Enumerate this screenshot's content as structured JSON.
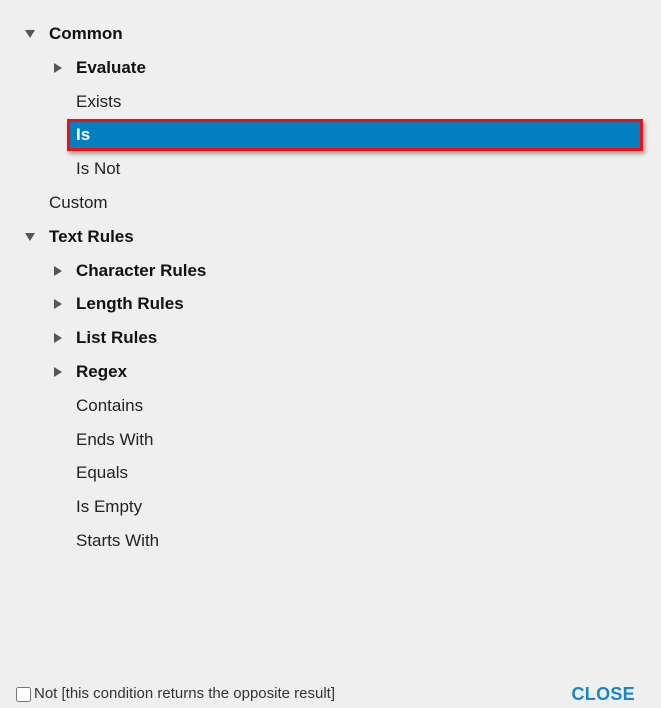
{
  "tree": {
    "common": {
      "label": "Common",
      "expanded": true,
      "children": {
        "evaluate": {
          "label": "Evaluate",
          "expanded": false
        },
        "exists": {
          "label": "Exists"
        },
        "is": {
          "label": "Is",
          "selected": true
        },
        "is_not": {
          "label": "Is Not"
        }
      }
    },
    "custom": {
      "label": "Custom"
    },
    "text_rules": {
      "label": "Text Rules",
      "expanded": true,
      "children": {
        "character_rules": {
          "label": "Character Rules",
          "expanded": false
        },
        "length_rules": {
          "label": "Length Rules",
          "expanded": false
        },
        "list_rules": {
          "label": "List Rules",
          "expanded": false
        },
        "regex": {
          "label": "Regex",
          "expanded": false
        },
        "contains": {
          "label": "Contains"
        },
        "ends_with": {
          "label": "Ends With"
        },
        "equals": {
          "label": "Equals"
        },
        "is_empty": {
          "label": "Is Empty"
        },
        "starts_with": {
          "label": "Starts With"
        }
      }
    }
  },
  "footer": {
    "not_checkbox_label": "Not [this condition returns the opposite result]",
    "not_checked": false,
    "close_label": "CLOSE"
  },
  "colors": {
    "selection": "#0080c0",
    "highlight_border": "#ee1111",
    "close_text": "#1a87c4",
    "background": "#efefef"
  }
}
